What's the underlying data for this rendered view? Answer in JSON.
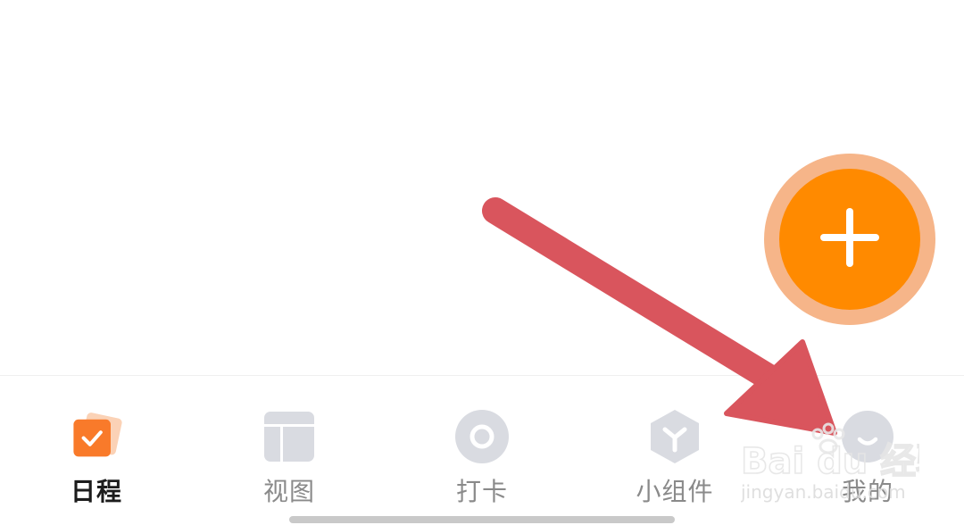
{
  "colors": {
    "accent": "#ff8a00",
    "accent_halo": "#f6b589",
    "tab_active_icon": "#f97a2a",
    "tab_inactive_icon": "#d9dbe1",
    "annotation_arrow": "#d9555d"
  },
  "fab": {
    "icon": "plus-icon"
  },
  "tabbar": {
    "tabs": [
      {
        "label": "日程",
        "icon": "schedule-check-icon",
        "active": true
      },
      {
        "label": "视图",
        "icon": "view-layout-icon",
        "active": false
      },
      {
        "label": "打卡",
        "icon": "check-in-ring-icon",
        "active": false
      },
      {
        "label": "小组件",
        "icon": "widget-cube-icon",
        "active": false
      },
      {
        "label": "我的",
        "icon": "profile-face-icon",
        "active": false
      }
    ]
  },
  "watermark": {
    "brand": "Bai du 经验",
    "url": "jingyan.baidu.com"
  }
}
